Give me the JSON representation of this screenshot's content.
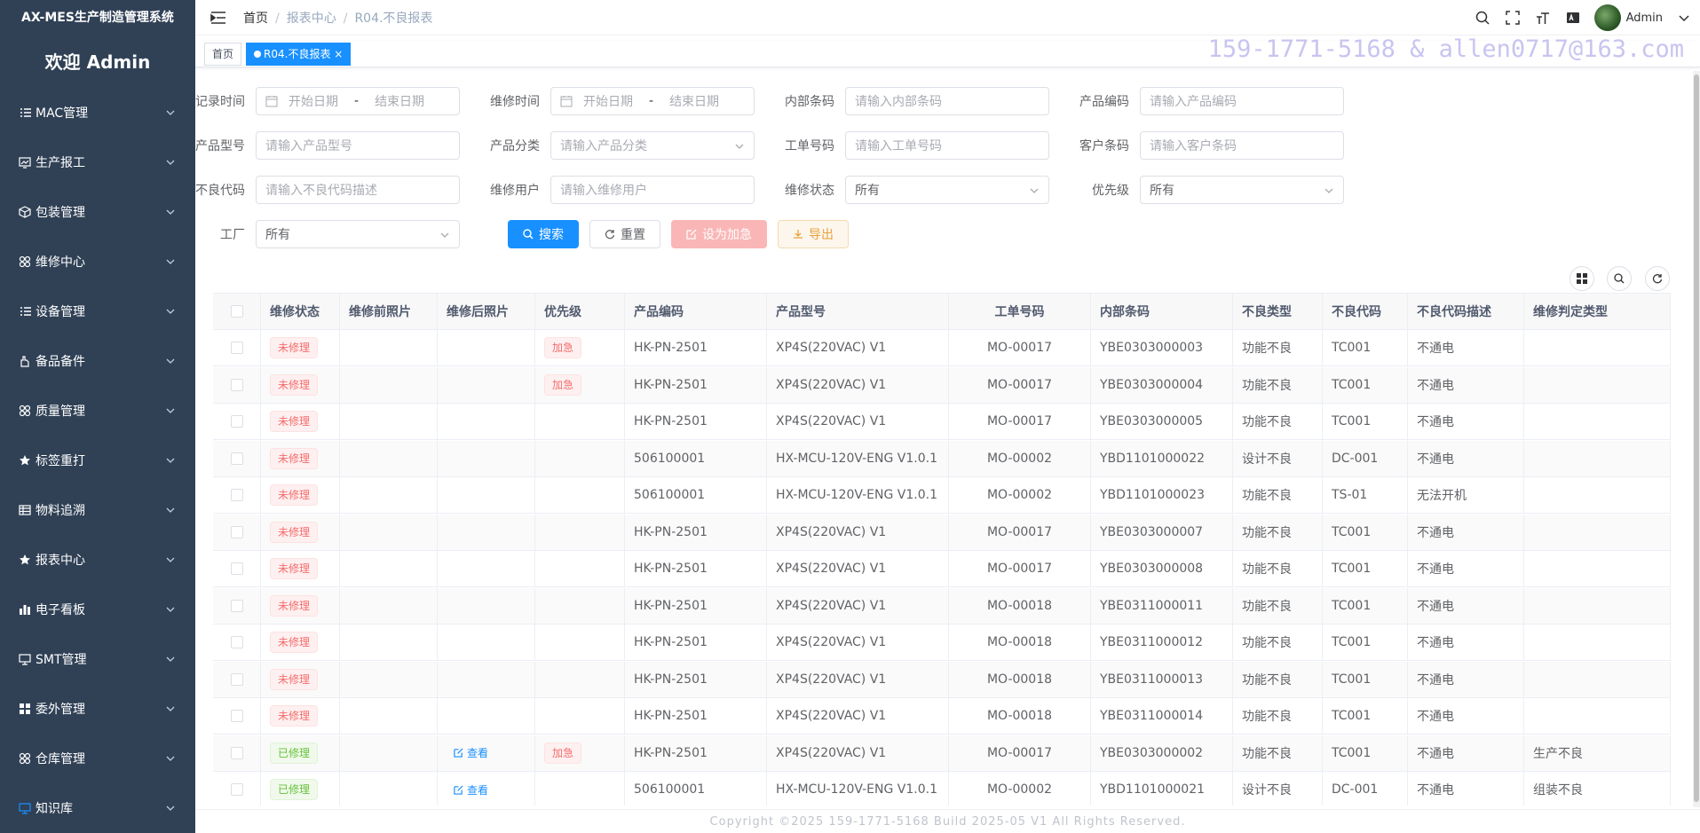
{
  "app_title": "AX-MES生产制造管理系统",
  "welcome": "欢迎 Admin",
  "sidebar": {
    "items": [
      {
        "label": "MAC管理",
        "icon": "list-icon"
      },
      {
        "label": "生产报工",
        "icon": "chart-board-icon"
      },
      {
        "label": "包装管理",
        "icon": "box-icon"
      },
      {
        "label": "维修中心",
        "icon": "grid-icon"
      },
      {
        "label": "设备管理",
        "icon": "list-icon"
      },
      {
        "label": "备品备件",
        "icon": "hand-icon"
      },
      {
        "label": "质量管理",
        "icon": "grid-icon"
      },
      {
        "label": "标签重打",
        "icon": "star-icon"
      },
      {
        "label": "物料追溯",
        "icon": "table-icon"
      },
      {
        "label": "报表中心",
        "icon": "star-icon"
      },
      {
        "label": "电子看板",
        "icon": "bar-chart-icon"
      },
      {
        "label": "SMT管理",
        "icon": "monitor-icon"
      },
      {
        "label": "委外管理",
        "icon": "apps-icon"
      },
      {
        "label": "仓库管理",
        "icon": "grid-icon"
      },
      {
        "label": "知识库",
        "icon": "monitor-icon"
      }
    ]
  },
  "header": {
    "breadcrumb": [
      "首页",
      "报表中心",
      "R04.不良报表"
    ],
    "user": "Admin"
  },
  "tags": [
    "首页",
    "R04.不良报表"
  ],
  "watermark": "159-1771-5168 & allen0717@163.com",
  "form": {
    "record_time_label": "记录时间",
    "repair_time_label": "维修时间",
    "start_date": "开始日期",
    "end_date": "结束日期",
    "date_sep": "-",
    "inner_code_label": "内部条码",
    "inner_code_ph": "请输入内部条码",
    "product_code_label": "产品编码",
    "product_code_ph": "请输入产品编码",
    "product_model_label": "产品型号",
    "product_model_ph": "请输入产品型号",
    "product_cat_label": "产品分类",
    "product_cat_ph": "请输入产品分类",
    "work_order_label": "工单号码",
    "work_order_ph": "请输入工单号码",
    "customer_code_label": "客户条码",
    "customer_code_ph": "请输入客户条码",
    "defect_code_label": "不良代码",
    "defect_code_ph": "请输入不良代码描述",
    "repair_user_label": "维修用户",
    "repair_user_ph": "请输入维修用户",
    "repair_status_label": "维修状态",
    "repair_status_val": "所有",
    "priority_label": "优先级",
    "priority_val": "所有",
    "factory_label": "工厂",
    "factory_val": "所有",
    "search_btn": "搜索",
    "reset_btn": "重置",
    "urgent_btn": "设为加急",
    "export_btn": "导出"
  },
  "table": {
    "columns": [
      "维修状态",
      "维修前照片",
      "维修后照片",
      "优先级",
      "产品编码",
      "产品型号",
      "工单号码",
      "内部条码",
      "不良类型",
      "不良代码",
      "不良代码描述",
      "维修判定类型"
    ],
    "rows": [
      {
        "status": "未修理",
        "after": "",
        "priority": "加急",
        "product_code": "HK-PN-2501",
        "model": "XP4S(220VAC) V1",
        "wo": "MO-00017",
        "inner": "YBE0303000003",
        "dtype": "功能不良",
        "dcode": "TC001",
        "ddesc": "不通电",
        "judge": ""
      },
      {
        "status": "未修理",
        "after": "",
        "priority": "加急",
        "product_code": "HK-PN-2501",
        "model": "XP4S(220VAC) V1",
        "wo": "MO-00017",
        "inner": "YBE0303000004",
        "dtype": "功能不良",
        "dcode": "TC001",
        "ddesc": "不通电",
        "judge": ""
      },
      {
        "status": "未修理",
        "after": "",
        "priority": "",
        "product_code": "HK-PN-2501",
        "model": "XP4S(220VAC) V1",
        "wo": "MO-00017",
        "inner": "YBE0303000005",
        "dtype": "功能不良",
        "dcode": "TC001",
        "ddesc": "不通电",
        "judge": ""
      },
      {
        "status": "未修理",
        "after": "",
        "priority": "",
        "product_code": "506100001",
        "model": "HX-MCU-120V-ENG V1.0.1",
        "wo": "MO-00002",
        "inner": "YBD1101000022",
        "dtype": "设计不良",
        "dcode": "DC-001",
        "ddesc": "不通电",
        "judge": ""
      },
      {
        "status": "未修理",
        "after": "",
        "priority": "",
        "product_code": "506100001",
        "model": "HX-MCU-120V-ENG V1.0.1",
        "wo": "MO-00002",
        "inner": "YBD1101000023",
        "dtype": "功能不良",
        "dcode": "TS-01",
        "ddesc": "无法开机",
        "judge": ""
      },
      {
        "status": "未修理",
        "after": "",
        "priority": "",
        "product_code": "HK-PN-2501",
        "model": "XP4S(220VAC) V1",
        "wo": "MO-00017",
        "inner": "YBE0303000007",
        "dtype": "功能不良",
        "dcode": "TC001",
        "ddesc": "不通电",
        "judge": ""
      },
      {
        "status": "未修理",
        "after": "",
        "priority": "",
        "product_code": "HK-PN-2501",
        "model": "XP4S(220VAC) V1",
        "wo": "MO-00017",
        "inner": "YBE0303000008",
        "dtype": "功能不良",
        "dcode": "TC001",
        "ddesc": "不通电",
        "judge": ""
      },
      {
        "status": "未修理",
        "after": "",
        "priority": "",
        "product_code": "HK-PN-2501",
        "model": "XP4S(220VAC) V1",
        "wo": "MO-00018",
        "inner": "YBE0311000011",
        "dtype": "功能不良",
        "dcode": "TC001",
        "ddesc": "不通电",
        "judge": ""
      },
      {
        "status": "未修理",
        "after": "",
        "priority": "",
        "product_code": "HK-PN-2501",
        "model": "XP4S(220VAC) V1",
        "wo": "MO-00018",
        "inner": "YBE0311000012",
        "dtype": "功能不良",
        "dcode": "TC001",
        "ddesc": "不通电",
        "judge": ""
      },
      {
        "status": "未修理",
        "after": "",
        "priority": "",
        "product_code": "HK-PN-2501",
        "model": "XP4S(220VAC) V1",
        "wo": "MO-00018",
        "inner": "YBE0311000013",
        "dtype": "功能不良",
        "dcode": "TC001",
        "ddesc": "不通电",
        "judge": ""
      },
      {
        "status": "未修理",
        "after": "",
        "priority": "",
        "product_code": "HK-PN-2501",
        "model": "XP4S(220VAC) V1",
        "wo": "MO-00018",
        "inner": "YBE0311000014",
        "dtype": "功能不良",
        "dcode": "TC001",
        "ddesc": "不通电",
        "judge": ""
      },
      {
        "status": "已修理",
        "after": "查看",
        "priority": "加急",
        "product_code": "HK-PN-2501",
        "model": "XP4S(220VAC) V1",
        "wo": "MO-00017",
        "inner": "YBE0303000002",
        "dtype": "功能不良",
        "dcode": "TC001",
        "ddesc": "不通电",
        "judge": "生产不良"
      },
      {
        "status": "已修理",
        "after": "查看",
        "priority": "",
        "product_code": "506100001",
        "model": "HX-MCU-120V-ENG V1.0.1",
        "wo": "MO-00002",
        "inner": "YBD1101000021",
        "dtype": "设计不良",
        "dcode": "DC-001",
        "ddesc": "不通电",
        "judge": "组装不良"
      }
    ]
  },
  "footer": "Copyright ©2025 159-1771-5168 Build 2025-05 V1 All Rights Reserved."
}
